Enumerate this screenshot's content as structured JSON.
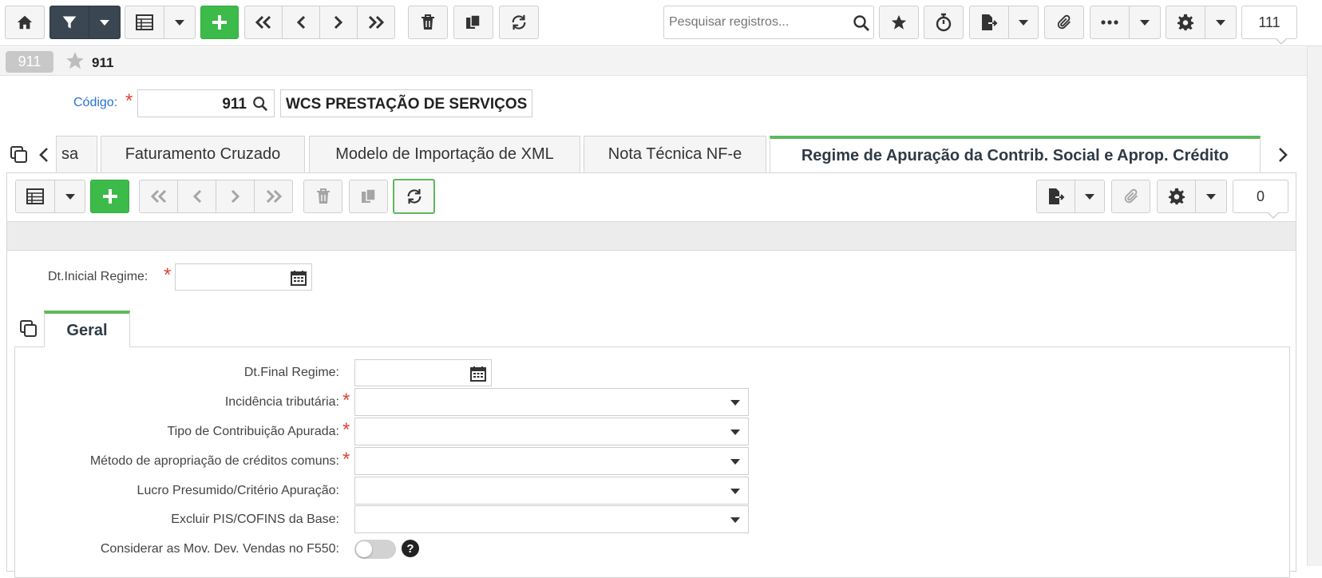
{
  "toolbar": {
    "search_placeholder": "Pesquisar registros...",
    "record_count": "111"
  },
  "header": {
    "record_badge": "911",
    "record_title": "911"
  },
  "form": {
    "codigo_label": "Código:",
    "codigo_value": "911",
    "razao_value": "WCS PRESTAÇÃO DE SERVIÇOS"
  },
  "tabs": [
    {
      "label": "sa"
    },
    {
      "label": "Faturamento Cruzado"
    },
    {
      "label": "Modelo de Importação de XML"
    },
    {
      "label": "Nota Técnica NF-e"
    },
    {
      "label": "Regime de Apuração da Contrib. Social e Aprop. Crédito"
    }
  ],
  "subtoolbar": {
    "record_count": "0"
  },
  "detail": {
    "dt_inicial_label": "Dt.Inicial Regime:",
    "subtab_geral": "Geral",
    "fields": [
      {
        "label": "Dt.Final Regime:"
      },
      {
        "label": "Incidência tributária:"
      },
      {
        "label": "Tipo de Contribuição Apurada:"
      },
      {
        "label": "Método de apropriação de créditos comuns:"
      },
      {
        "label": "Lucro Presumido/Critério Apuração:"
      },
      {
        "label": "Excluir PIS/COFINS da Base:"
      },
      {
        "label": "Considerar as Mov. Dev. Vendas no F550:"
      }
    ]
  },
  "colors": {
    "accent_green": "#3dbb4a",
    "dark_button": "#3a4652",
    "required_red": "#d9463a",
    "link_blue": "#2a72d6"
  }
}
